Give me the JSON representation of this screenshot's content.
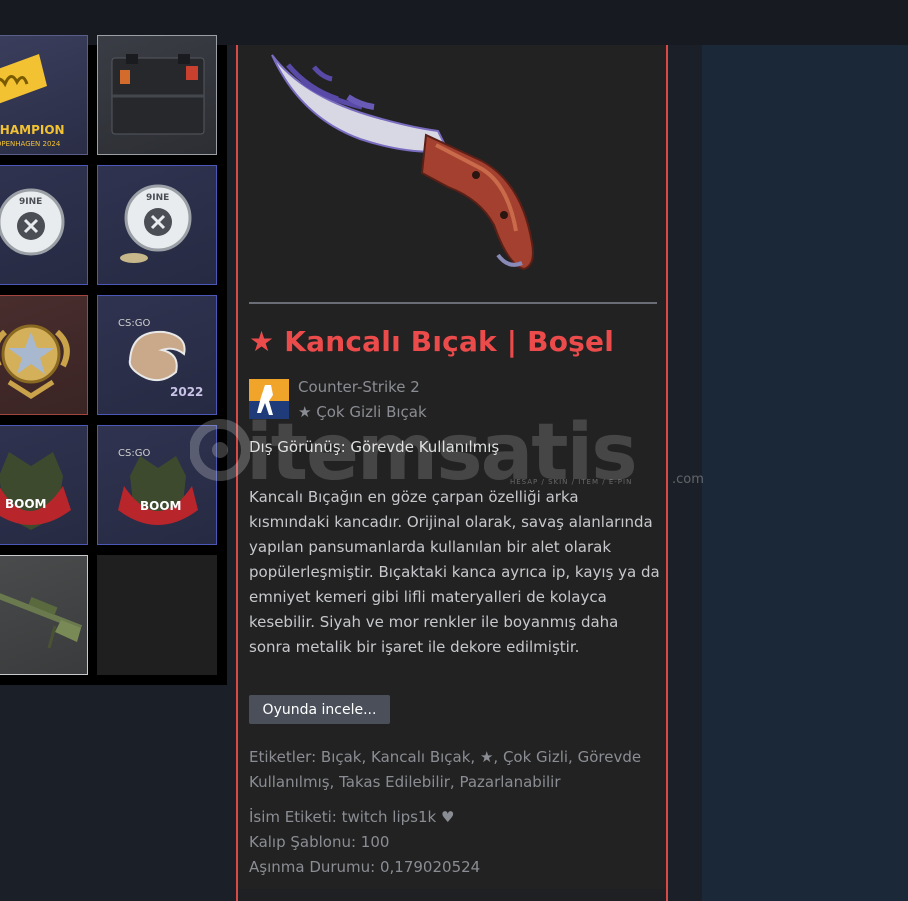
{
  "item": {
    "title": "★ Kancalı Bıçak | Boşel",
    "title_color": "#eb4b4b",
    "game": "Counter-Strike 2",
    "rarity": "★ Çok Gizli Bıçak",
    "exterior": "Dış Görünüş: Görevde Kullanılmış",
    "description_lines": [
      "Kancalı Bıçağın en göze çarpan özelliği arka",
      "kısmındaki kancadır. Orijinal olarak, savaş alanlarında",
      "yapılan pansumanlarda kullanılan bir alet olarak",
      "popülerleşmiştir. Bıçaktaki kanca ayrıca ip, kayış ya da",
      "emniyet kemeri gibi lifli materyalleri de kolayca",
      "kesebilir. Siyah ve mor renkler ile boyanmış daha",
      "sonra metalik bir işaret ile dekore edilmiştir."
    ],
    "inspect_button": "Oyunda incele...",
    "tags_lines": [
      "Etiketler: Bıçak, Kancalı Bıçak, ★, Çok Gizli, Görevde",
      "Kullanılmış, Takas Edilebilir, Pazarlanabilir"
    ],
    "name_tag": "İsim Etiketi: twitch lips1k ♥",
    "pattern": "Kalıp Şablonu: 100",
    "wear": "Aşınma Durumu: 0,179020524"
  },
  "inventory": {
    "items": [
      {
        "kind": "sticker-gold-signature",
        "border": "#5a5f8a",
        "text": "CHAMPION"
      },
      {
        "kind": "weapon-case",
        "border": "#9aa0a6"
      },
      {
        "kind": "sticker-9ine",
        "border": "#4b58b8",
        "text": "9INE"
      },
      {
        "kind": "sticker-9ine",
        "border": "#4b58b8",
        "text": "9INE"
      },
      {
        "kind": "service-medal",
        "border": "#a5453f"
      },
      {
        "kind": "sticker-furia",
        "border": "#4b58b8",
        "text": "CS:GO"
      },
      {
        "kind": "sticker-boom",
        "border": "#4b58b8",
        "text": "BOOM"
      },
      {
        "kind": "sticker-boom",
        "border": "#4b58b8",
        "text": "BOOM"
      },
      {
        "kind": "rifle-awp",
        "border": "#c7c9cc"
      },
      {
        "kind": "empty-slot",
        "border": ""
      }
    ]
  },
  "watermark": {
    "brand": "itemsatis",
    "tagline": "HESAP / SKIN / ITEM / E-PIN",
    "suffix": ".com"
  }
}
